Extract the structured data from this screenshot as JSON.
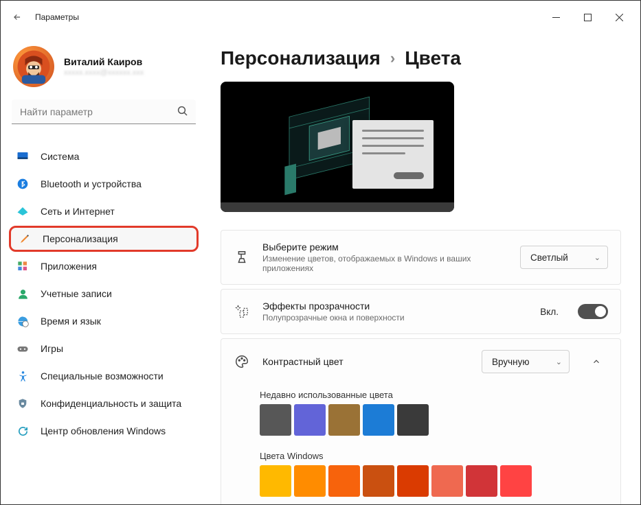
{
  "window": {
    "title": "Параметры"
  },
  "user": {
    "name": "Виталий Каиров",
    "email": "xxxxx.xxxx@xxxxxx.xxx"
  },
  "search": {
    "placeholder": "Найти параметр"
  },
  "sidebar": {
    "items": [
      {
        "label": "Система"
      },
      {
        "label": "Bluetooth и устройства"
      },
      {
        "label": "Сеть и Интернет"
      },
      {
        "label": "Персонализация"
      },
      {
        "label": "Приложения"
      },
      {
        "label": "Учетные записи"
      },
      {
        "label": "Время и язык"
      },
      {
        "label": "Игры"
      },
      {
        "label": "Специальные возможности"
      },
      {
        "label": "Конфиденциальность и защита"
      },
      {
        "label": "Центр обновления Windows"
      }
    ]
  },
  "breadcrumb": {
    "root": "Персонализация",
    "current": "Цвета"
  },
  "settings": {
    "mode": {
      "title": "Выберите режим",
      "desc": "Изменение цветов, отображаемых в Windows и ваших приложениях",
      "value": "Светлый"
    },
    "transparency": {
      "title": "Эффекты прозрачности",
      "desc": "Полупрозрачные окна и поверхности",
      "state_label": "Вкл.",
      "on": true
    },
    "accent": {
      "title": "Контрастный цвет",
      "value": "Вручную",
      "recent_label": "Недавно использованные цвета",
      "recent_colors": [
        "#575757",
        "#6264d8",
        "#9a7236",
        "#1c7cd6",
        "#3a3a3a"
      ],
      "windows_label": "Цвета Windows",
      "windows_colors": [
        "#ffb900",
        "#ff8c00",
        "#f7630c",
        "#ca5010",
        "#da3b01",
        "#ef6950",
        "#d13438",
        "#ff4343"
      ]
    }
  }
}
